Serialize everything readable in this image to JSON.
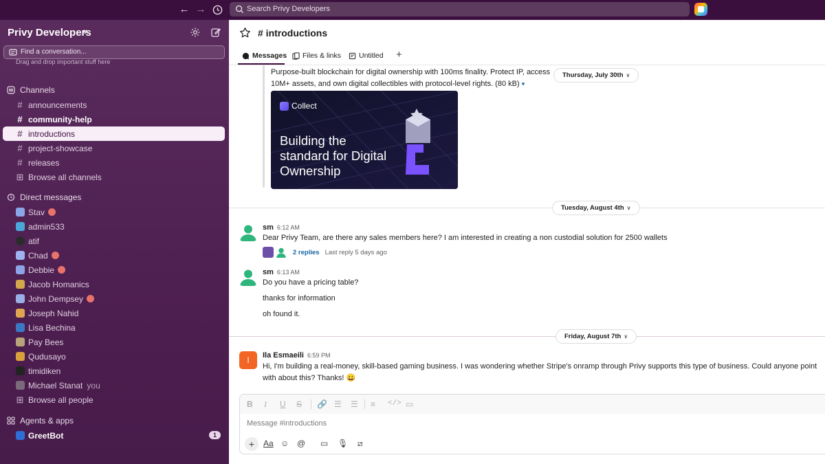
{
  "topbar": {
    "search_placeholder": "Search Privy Developers"
  },
  "sidebar": {
    "workspace_name": "Privy Developers",
    "find_placeholder": "Find a conversation...",
    "drag_hint": "Drag and drop important stuff here",
    "channels_header": "Channels",
    "channels": [
      {
        "name": "announcements"
      },
      {
        "name": "community-help"
      },
      {
        "name": "introductions"
      },
      {
        "name": "project-showcase"
      },
      {
        "name": "releases"
      }
    ],
    "browse_channels": "Browse all channels",
    "dm_header": "Direct messages",
    "dms": [
      {
        "name": "Stav"
      },
      {
        "name": "admin533"
      },
      {
        "name": "atif"
      },
      {
        "name": "Chad"
      },
      {
        "name": "Debbie"
      },
      {
        "name": "Jacob Homanics"
      },
      {
        "name": "John Dempsey"
      },
      {
        "name": "Joseph Nahid"
      },
      {
        "name": "Lisa Bechina"
      },
      {
        "name": "Pay Bees"
      },
      {
        "name": "Qudusayo"
      },
      {
        "name": "timidiken"
      },
      {
        "name": "Michael Stanat",
        "tag": "you"
      }
    ],
    "browse_people": "Browse all people",
    "apps_header": "Agents & apps",
    "apps": [
      {
        "name": "GreetBot",
        "badge": "1"
      }
    ]
  },
  "channel": {
    "title": "# introductions",
    "tabs": {
      "messages": "Messages",
      "files": "Files & links",
      "untitled": "Untitled"
    }
  },
  "messages": {
    "link_desc_1": "Purpose-built blockchain for digital ownership with 100ms finality. Protect IP, access",
    "link_desc_2": "10M+ assets, and own digital collectibles with protocol-level rights. (80 kB)",
    "link_desc_caret": "▾",
    "preview_logo": "Collect",
    "preview_headline": "Building the standard for Digital Ownership",
    "date_1": "Thursday, July 30th",
    "date_2": "Tuesday, August 4th",
    "date_3": "Friday, August 7th",
    "m1": {
      "author": "sm",
      "time": "6:12 AM",
      "text": "Dear Privy Team, are there any sales members here? I am interested in creating a non custodial solution for 2500 wallets",
      "replies": "2 replies",
      "last_reply": "Last reply 5 days ago"
    },
    "m2": {
      "author": "sm",
      "time": "6:13 AM",
      "text_1": "Do you have a pricing table?",
      "text_2": "thanks for information",
      "text_3": "oh found it."
    },
    "m3": {
      "author": "Ila Esmaeili",
      "time": "6:59 PM",
      "avatar_letter": "I",
      "text_1": "Hi, I'm building a real-money, skill-based gaming business. I was wondering whether Stripe's onramp through Privy supports this type of business. Could anyone point",
      "text_2": "with about this? Thanks! 😀"
    }
  },
  "composer": {
    "placeholder": "Message #introductions",
    "aa_label": "Aa"
  }
}
